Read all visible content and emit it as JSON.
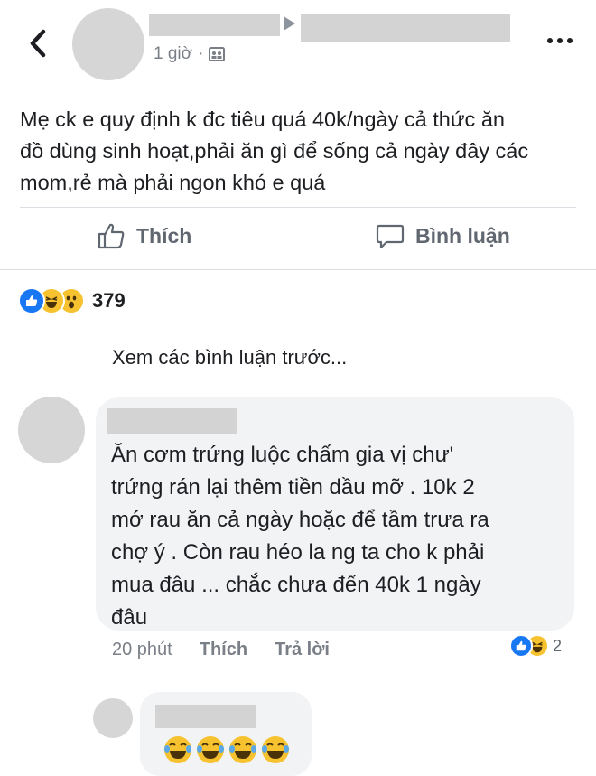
{
  "header": {
    "time_label": "1 giờ",
    "separator": "·",
    "privacy_icon": "group-privacy-icon",
    "back_icon": "chevron-left-icon",
    "more_icon": "more-dots-icon"
  },
  "post": {
    "text": "Mẹ ck e quy định k đc tiêu quá 40k/ngày cả thức ăn\nđồ dùng sinh hoạt,phải ăn gì để sống cả ngày đây các\nmom,rẻ mà phải ngon khó e quá"
  },
  "actions": {
    "like_label": "Thích",
    "comment_label": "Bình luận"
  },
  "reactions": {
    "types": [
      "like",
      "haha",
      "wow"
    ],
    "count": "379"
  },
  "comments_link": "Xem các bình luận trước...",
  "comment1": {
    "text": "Ăn cơm trứng luộc chấm gia vị chư'\ntrứng rán lại thêm tiền dầu mỡ . 10k 2\nmớ rau ăn cả ngày hoặc để tầm trưa ra\nchợ ý . Còn rau héo la ng ta cho k phải\nmua đâu ... chắc chưa đến 40k 1 ngày\nđâu",
    "time": "20 phút",
    "like_label": "Thích",
    "reply_label": "Trả lời",
    "reaction_types": [
      "like",
      "haha"
    ],
    "reaction_count": "2"
  },
  "comment2": {
    "emoji_count": 4,
    "emoji": "laughing-tears-icon"
  },
  "colors": {
    "accent_blue": "#1877f2",
    "reaction_yellow": "#f7c22f",
    "bubble_bg": "#f2f3f5",
    "muted_text": "#7a7f87"
  }
}
